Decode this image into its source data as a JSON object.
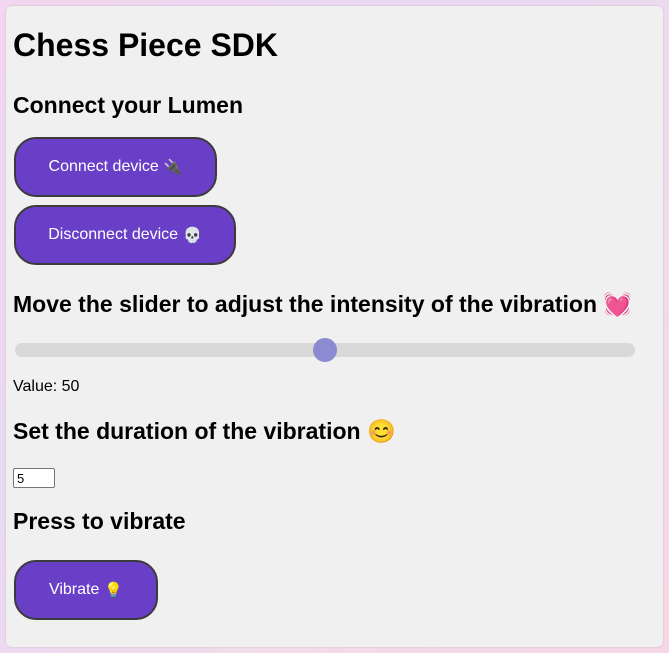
{
  "page_title": "Chess Piece SDK",
  "connect_section": {
    "heading": "Connect your Lumen",
    "connect_button": {
      "label": "Connect device",
      "emoji": "🔌"
    },
    "disconnect_button": {
      "label": "Disconnect device",
      "emoji": "💀"
    }
  },
  "intensity_section": {
    "heading": "Move the slider to adjust the intensity of the vibration",
    "heading_emoji": "💓",
    "slider": {
      "min": 0,
      "max": 100,
      "value": 50
    },
    "value_text": "Value: 50"
  },
  "duration_section": {
    "heading": "Set the duration of the vibration",
    "heading_emoji": "😊",
    "input_value": "5"
  },
  "vibrate_section": {
    "heading": "Press to vibrate",
    "vibrate_button": {
      "label": "Vibrate",
      "emoji": "💡"
    }
  },
  "colors": {
    "button_bg": "#6a3fc7",
    "slider_thumb": "#8a8bd0",
    "slider_track": "#d9d9d9"
  }
}
